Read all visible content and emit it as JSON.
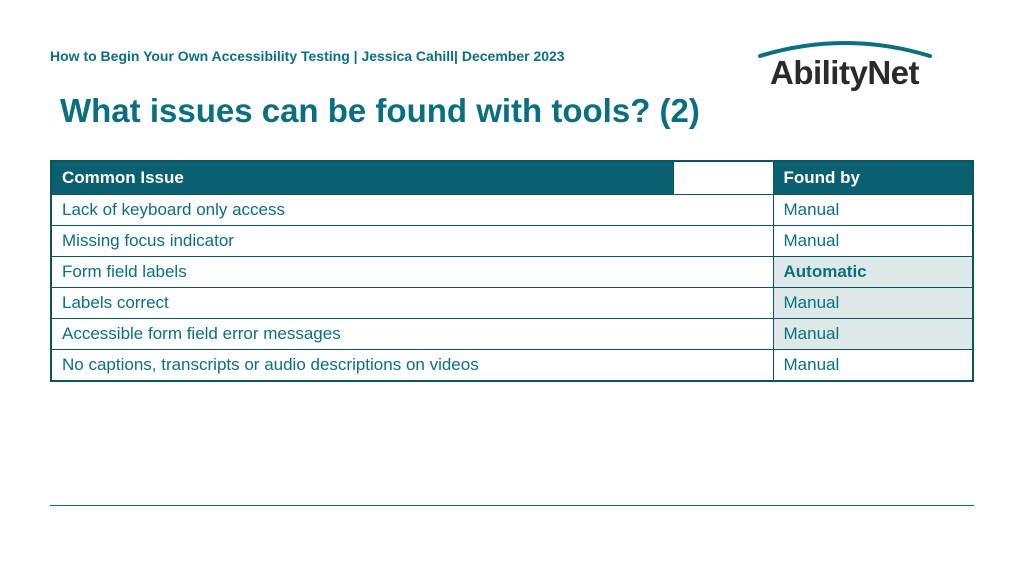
{
  "header": {
    "breadcrumb": "How to Begin Your Own Accessibility Testing | Jessica Cahill| December 2023",
    "logo_text": "AbilityNet"
  },
  "title": "What issues can be found with tools? (2)",
  "table": {
    "headers": {
      "issue": "Common Issue",
      "found_by": "Found by"
    },
    "rows": [
      {
        "issue": "Lack of keyboard only access",
        "found_by": "Manual",
        "highlight": false,
        "shaded": false
      },
      {
        "issue": "Missing focus indicator",
        "found_by": "Manual",
        "highlight": false,
        "shaded": false
      },
      {
        "issue": "Form field labels",
        "found_by": "Automatic",
        "highlight": true,
        "shaded": false
      },
      {
        "issue": "Labels correct",
        "found_by": "Manual",
        "highlight": false,
        "shaded": true
      },
      {
        "issue": "Accessible form field error messages",
        "found_by": "Manual",
        "highlight": false,
        "shaded": true
      },
      {
        "issue": "No captions, transcripts or audio descriptions on videos",
        "found_by": "Manual",
        "highlight": false,
        "shaded": false
      }
    ]
  }
}
